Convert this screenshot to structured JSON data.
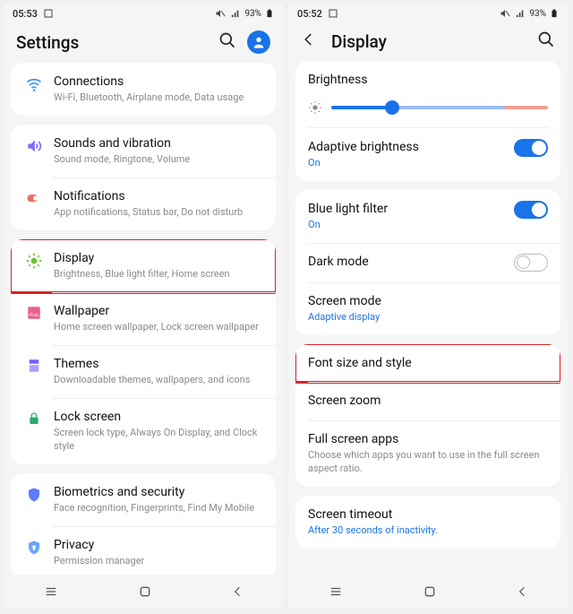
{
  "left": {
    "status": {
      "time": "05:53",
      "battery": "93%"
    },
    "header": {
      "title": "Settings"
    },
    "groups": [
      [
        {
          "key": "connections",
          "title": "Connections",
          "sub": "Wi-Fi, Bluetooth, Airplane mode, Data usage",
          "icon": "wifi",
          "color": "#3b93ff"
        }
      ],
      [
        {
          "key": "sounds",
          "title": "Sounds and vibration",
          "sub": "Sound mode, Ringtone, Volume",
          "icon": "sound",
          "color": "#7c6cff"
        },
        {
          "key": "notifications",
          "title": "Notifications",
          "sub": "App notifications, Status bar, Do not disturb",
          "icon": "notif",
          "color": "#e57368"
        }
      ],
      [
        {
          "key": "display",
          "title": "Display",
          "sub": "Brightness, Blue light filter, Home screen",
          "icon": "display",
          "color": "#6fbf3b",
          "highlight": true
        },
        {
          "key": "wallpaper",
          "title": "Wallpaper",
          "sub": "Home screen wallpaper, Lock screen wallpaper",
          "icon": "wallpaper",
          "color": "#e8628b"
        },
        {
          "key": "themes",
          "title": "Themes",
          "sub": "Downloadable themes, wallpapers, and icons",
          "icon": "themes",
          "color": "#7c5cff"
        },
        {
          "key": "lockscreen",
          "title": "Lock screen",
          "sub": "Screen lock type, Always On Display, and Clock style",
          "icon": "lock",
          "color": "#2aa86f"
        }
      ],
      [
        {
          "key": "biometrics",
          "title": "Biometrics and security",
          "sub": "Face recognition, Fingerprints, Find My Mobile",
          "icon": "shield",
          "color": "#5b7cff"
        },
        {
          "key": "privacy",
          "title": "Privacy",
          "sub": "Permission manager",
          "icon": "privacy",
          "color": "#6aa6ff"
        }
      ]
    ]
  },
  "right": {
    "status": {
      "time": "05:52",
      "battery": "93%"
    },
    "header": {
      "title": "Display"
    },
    "groups": [
      [
        {
          "key": "brightness",
          "title": "Brightness",
          "slider": true
        },
        {
          "key": "adaptive",
          "title": "Adaptive brightness",
          "sub": "On",
          "accent": true,
          "toggle": "on"
        }
      ],
      [
        {
          "key": "bluelight",
          "title": "Blue light filter",
          "sub": "On",
          "accent": true,
          "toggle": "on"
        },
        {
          "key": "darkmode",
          "title": "Dark mode",
          "toggle": "off"
        },
        {
          "key": "screenmode",
          "title": "Screen mode",
          "sub": "Adaptive display",
          "accent": true
        }
      ],
      [
        {
          "key": "fontsize",
          "title": "Font size and style",
          "highlight": true
        },
        {
          "key": "zoom",
          "title": "Screen zoom"
        },
        {
          "key": "fullscreen",
          "title": "Full screen apps",
          "sub": "Choose which apps you want to use in the full screen aspect ratio."
        }
      ],
      [
        {
          "key": "timeout",
          "title": "Screen timeout",
          "sub": "After 30 seconds of inactivity.",
          "accent": true
        }
      ]
    ]
  }
}
